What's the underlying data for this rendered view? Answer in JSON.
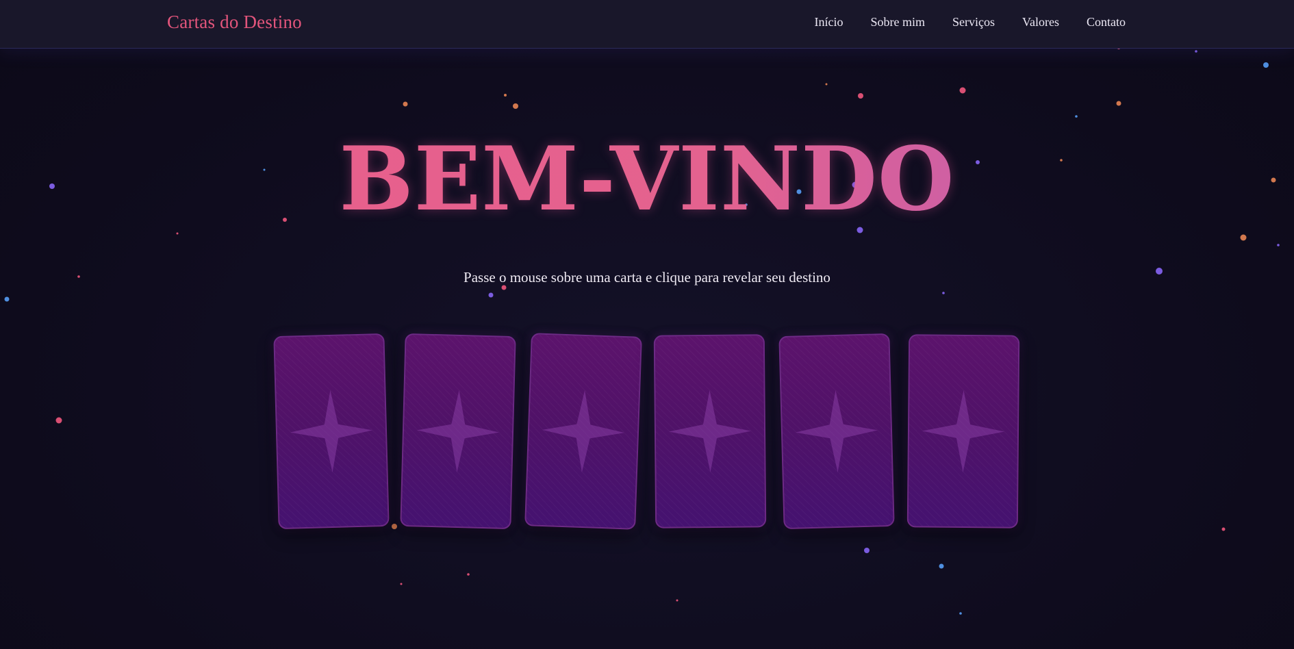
{
  "navbar": {
    "brand": "Cartas do Destino",
    "links": [
      "Início",
      "Sobre mim",
      "Serviços",
      "Valores",
      "Contato"
    ]
  },
  "hero": {
    "title": "BEM-VINDO",
    "subtitle": "Passe o mouse sobre uma carta e clique para revelar seu destino"
  },
  "cards": {
    "count": 6,
    "back_icon": "four-point-star-icon"
  },
  "colors": {
    "accent": "#e3557c",
    "title_gradient_start": "#ea5d8a",
    "title_gradient_end": "#b25cbe",
    "card_back": "#501268",
    "background": "#0f0c1e"
  }
}
